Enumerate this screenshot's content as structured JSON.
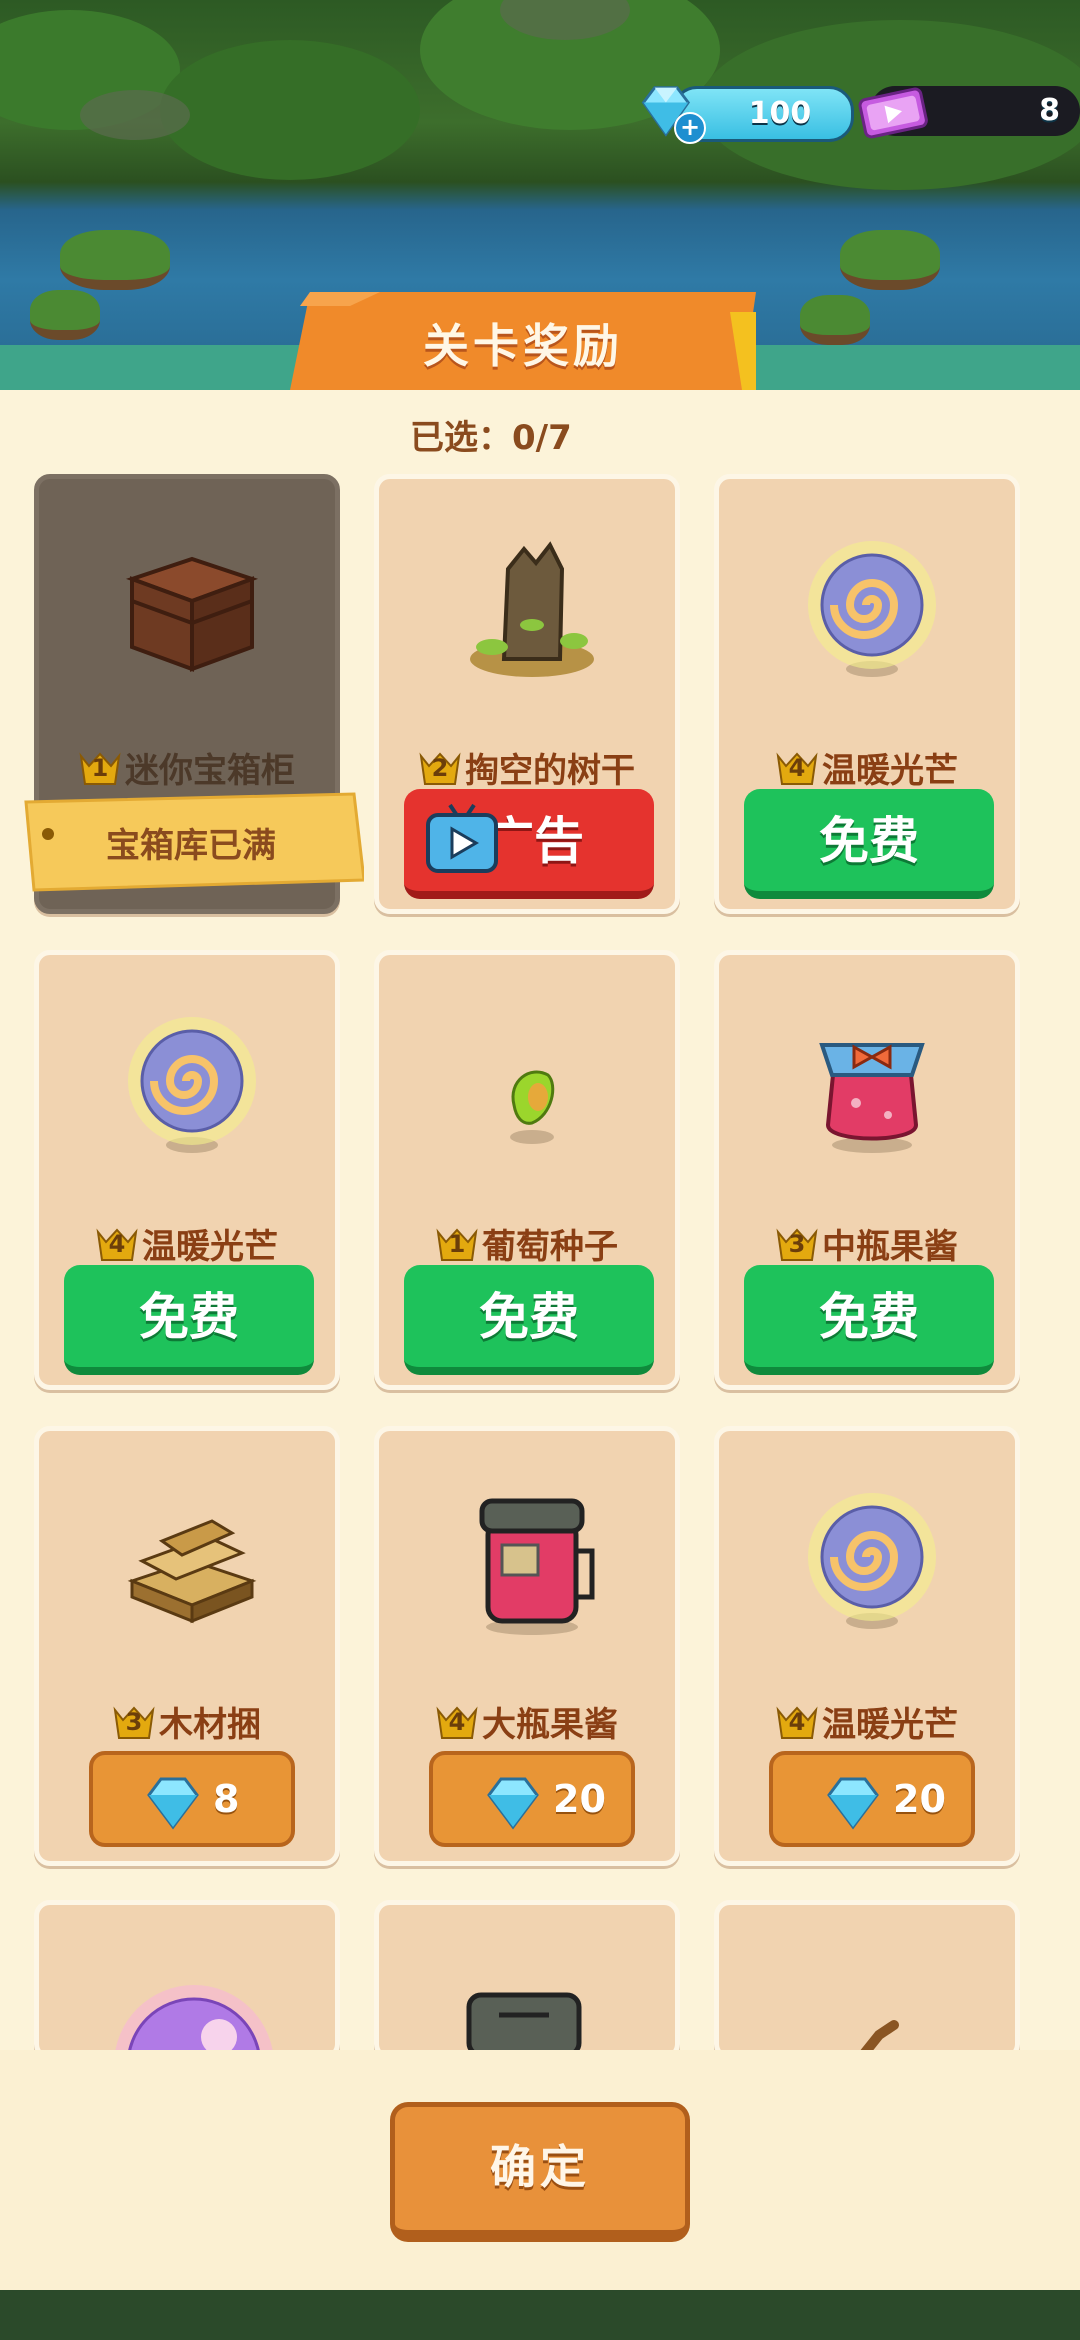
{
  "currency": {
    "gems": "100",
    "tickets": "8"
  },
  "panel": {
    "title": "关卡奖励",
    "selected_label": "已选：0/7"
  },
  "cards": [
    {
      "name": "迷你宝箱柜",
      "tier": "1",
      "icon": "chest-icon",
      "status": "宝箱库已满"
    },
    {
      "name": "掏空的树干",
      "tier": "2",
      "icon": "tree-stump-icon",
      "button": "广告"
    },
    {
      "name": "温暖光芒",
      "tier": "4",
      "icon": "warm-orb-icon",
      "button": "免费"
    },
    {
      "name": "温暖光芒",
      "tier": "4",
      "icon": "warm-orb-icon",
      "button": "免费"
    },
    {
      "name": "葡萄种子",
      "tier": "1",
      "icon": "seed-icon",
      "button": "免费"
    },
    {
      "name": "中瓶果酱",
      "tier": "3",
      "icon": "jam-jar-icon",
      "button": "免费"
    },
    {
      "name": "木材捆",
      "tier": "3",
      "icon": "wood-bundle-icon",
      "price": "8"
    },
    {
      "name": "大瓶果酱",
      "tier": "4",
      "icon": "big-jam-jar-icon",
      "price": "20"
    },
    {
      "name": "温暖光芒",
      "tier": "4",
      "icon": "warm-orb-icon",
      "price": "20"
    }
  ],
  "confirm_label": "确定",
  "colors": {
    "free_button": "#1ec25b",
    "ad_button": "#e5332e",
    "gem_button": "#e89536",
    "panel_bg": "#fcf3d9"
  }
}
